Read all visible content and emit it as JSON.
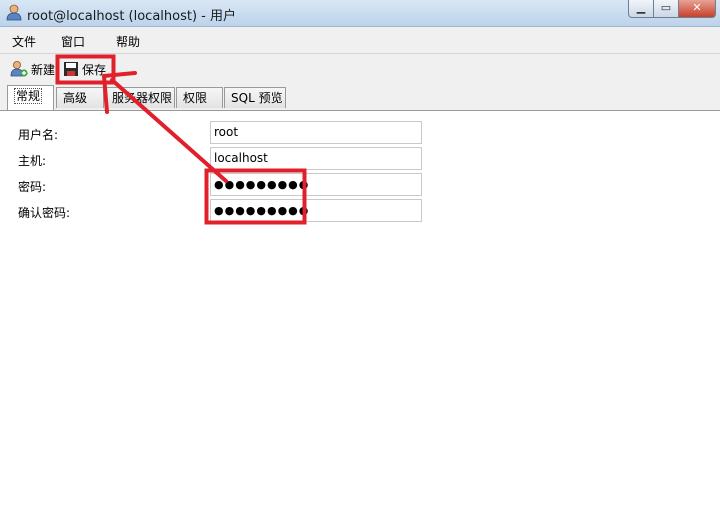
{
  "window": {
    "title": "root@localhost (localhost) - 用户",
    "minimize_icon": "minimize-icon",
    "maximize_icon": "maximize-icon",
    "close_icon": "close-icon"
  },
  "menubar": {
    "items": [
      {
        "label": "文件"
      },
      {
        "label": "窗口"
      },
      {
        "label": "帮助"
      }
    ]
  },
  "toolbar": {
    "new_label": "新建",
    "new_icon": "new-user-icon",
    "save_label": "保存",
    "save_icon": "floppy-disk-icon"
  },
  "tabs": [
    {
      "label": "常规",
      "active": true
    },
    {
      "label": "高级"
    },
    {
      "label": "服务器权限"
    },
    {
      "label": "权限"
    },
    {
      "label": "SQL 预览"
    }
  ],
  "form": {
    "username_label": "用户名:",
    "username_value": "root",
    "host_label": "主机:",
    "host_value": "localhost",
    "password_label": "密码:",
    "password_value": "●●●●●●●●●",
    "confirm_label": "确认密码:",
    "confirm_value": "●●●●●●●●●"
  },
  "annotation": {
    "color": "#e0202a"
  }
}
